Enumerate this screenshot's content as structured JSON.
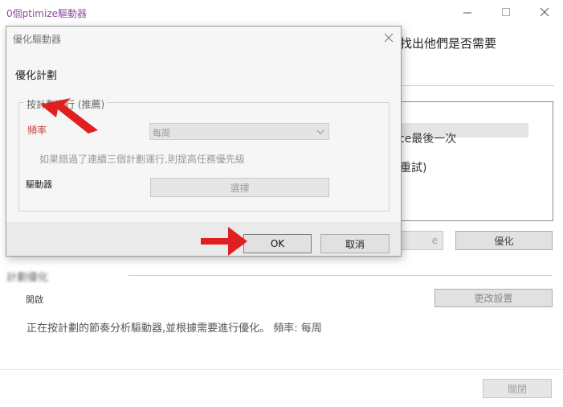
{
  "main": {
    "title": "0個ptimize驅動器",
    "intro_fragment": "找出他們是否需要",
    "list_line1_fragment": "ce最後一次",
    "list_line2_fragment": "重試)",
    "partial_button": "e",
    "optimize_button": "優化",
    "scheduled_heading": "計劃優化",
    "status_label": "開啟",
    "change_settings_button": "更改設置",
    "schedule_desc": "正在按計劃的節奏分析驅動器,並根據需要進行優化。 頻率: 每周",
    "close_button": "關閉"
  },
  "dialog": {
    "title": "優化驅動器",
    "heading": "優化計劃",
    "group_label": "按計劃運行 (推薦)",
    "frequency_label": "頻率",
    "frequency_value": "每周",
    "escalate_text": "如果錯過了連續三個計劃運行,則提高任務優先級",
    "drives_label": "驅動器",
    "choose_button": "選擇",
    "ok_button": "OK",
    "cancel_button": "取消"
  },
  "colors": {
    "dialog_footer": "#f0f0f0",
    "annotation_arrow": "#e02020",
    "title_purple": "#8a4fa0"
  }
}
